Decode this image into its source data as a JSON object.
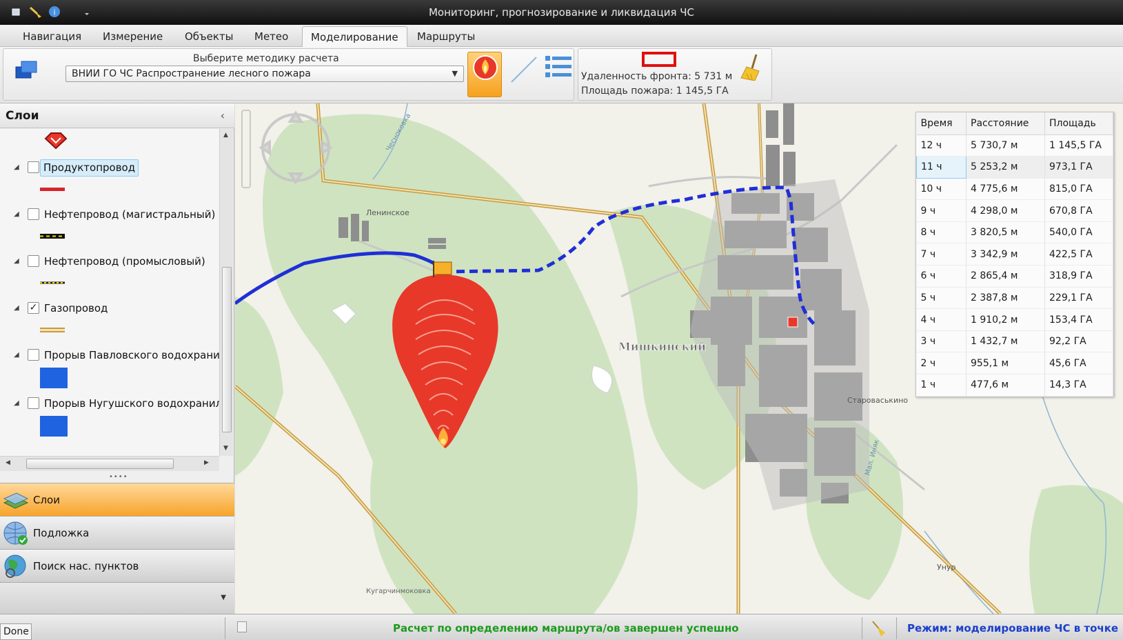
{
  "window": {
    "title": "Мониторинг, прогнозирование и ликвидация ЧС"
  },
  "menu": {
    "tabs": [
      {
        "label": "Навигация"
      },
      {
        "label": "Измерение"
      },
      {
        "label": "Объекты"
      },
      {
        "label": "Метео"
      },
      {
        "label": "Моделирование",
        "active": true
      },
      {
        "label": "Маршруты"
      }
    ]
  },
  "ribbon": {
    "method_label": "Выберите методику расчета",
    "method_value": "ВНИИ ГО ЧС Распространение лесного пожара",
    "front_distance": "Удаленность фронта: 5 731 м",
    "fire_area": "Площадь пожара: 1 145,5 ГА"
  },
  "layers_panel": {
    "title": "Слои",
    "items": [
      {
        "label": "Продуктопровод",
        "checked": false,
        "selected": true
      },
      {
        "label": "Нефтепровод (магистральный)",
        "checked": false
      },
      {
        "label": "Нефтепровод (промысловый)",
        "checked": false
      },
      {
        "label": "Газопровод",
        "checked": true
      },
      {
        "label": "Прорыв Павловского водохрани",
        "checked": false
      },
      {
        "label": "Прорыв Нугушского водохранил",
        "checked": false
      }
    ],
    "nav_buttons": [
      {
        "label": "Слои",
        "active": true
      },
      {
        "label": "Подложка"
      },
      {
        "label": "Поиск нас. пунктов"
      }
    ]
  },
  "map": {
    "labels": {
      "village1": "Ленинское",
      "town": "Мишкинский",
      "village2": "Староваськино",
      "river": "Унур",
      "river2": "Мал. Иняк",
      "bottom": "Кугарчинмоковка",
      "road": "Чесноковка"
    }
  },
  "results": {
    "headers": [
      "Время",
      "Расстояние",
      "Площадь"
    ],
    "rows": [
      [
        "12 ч",
        "5 730,7 м",
        "1 145,5 ГА"
      ],
      [
        "11 ч",
        "5 253,2 м",
        "973,1 ГА"
      ],
      [
        "10 ч",
        "4 775,6 м",
        "815,0 ГА"
      ],
      [
        "9 ч",
        "4 298,0 м",
        "670,8 ГА"
      ],
      [
        "8 ч",
        "3 820,5 м",
        "540,0 ГА"
      ],
      [
        "7 ч",
        "3 342,9 м",
        "422,5 ГА"
      ],
      [
        "6 ч",
        "2 865,4 м",
        "318,9 ГА"
      ],
      [
        "5 ч",
        "2 387,8 м",
        "229,1 ГА"
      ],
      [
        "4 ч",
        "1 910,2 м",
        "153,4 ГА"
      ],
      [
        "3 ч",
        "1 432,7 м",
        "92,2 ГА"
      ],
      [
        "2 ч",
        "955,1 м",
        "45,6 ГА"
      ],
      [
        "1 ч",
        "477,6 м",
        "14,3 ГА"
      ]
    ]
  },
  "status": {
    "done": "Done",
    "message": "Расчет по определению маршрута/ов завершен успешно",
    "mode": "Режим: моделирование ЧС в точке"
  },
  "colors": {
    "accent": "#f7a42a",
    "fire": "#e8382a",
    "route": "#1f2fd6",
    "ok_text": "#1d9b1d",
    "mode_text": "#1a3fcc"
  }
}
